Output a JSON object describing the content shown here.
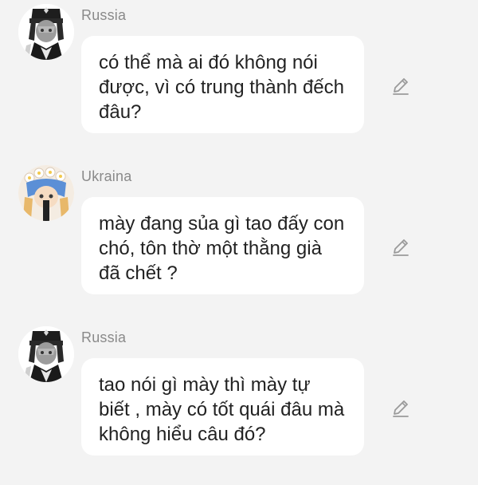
{
  "messages": [
    {
      "sender": "Russia",
      "text": " có thể mà ai đó không nói\nđược, vì có trung thành đếch\nđâu?",
      "avatar_icon": "russia-avatar",
      "edit_icon": "pencil-icon"
    },
    {
      "sender": "Ukraina",
      "text": "mày đang sủa gì tao đấy con\nchó, tôn thờ một thằng già\nđã chết ?",
      "avatar_icon": "ukraina-avatar",
      "edit_icon": "pencil-icon"
    },
    {
      "sender": "Russia",
      "text": "tao nói gì mày thì mày tự\nbiết , mày có tốt quái đâu mà\nkhông hiểu câu đó?",
      "avatar_icon": "russia-avatar",
      "edit_icon": "pencil-icon"
    }
  ],
  "colors": {
    "background": "#f3f3f3",
    "bubble": "#ffffff",
    "sender_name": "#8a8a8a",
    "message_text": "#222222",
    "edit_icon": "#9a9a9a"
  }
}
